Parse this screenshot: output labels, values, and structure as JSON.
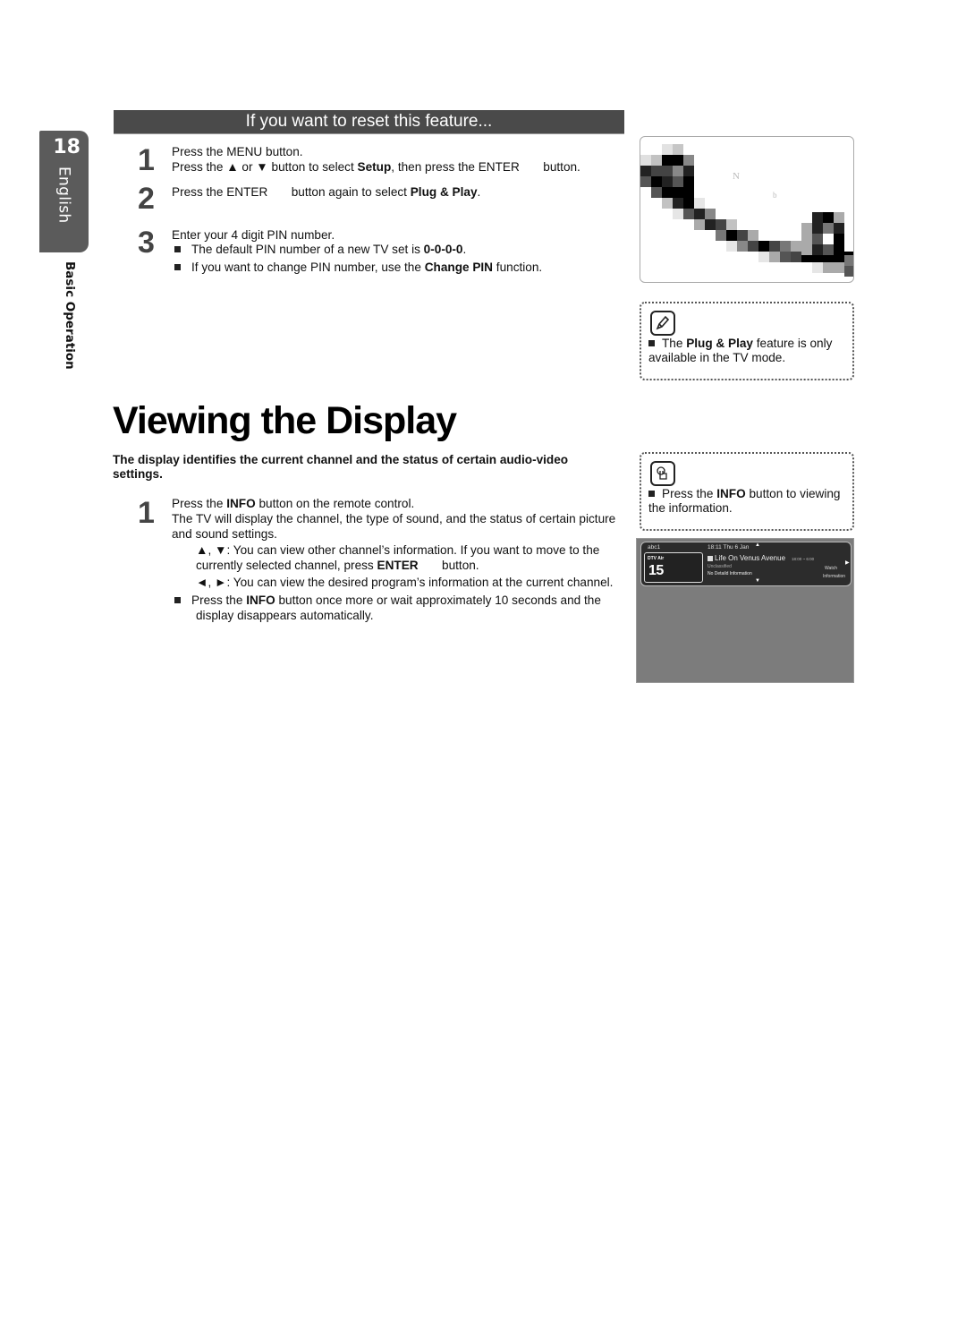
{
  "sidebar": {
    "page_number": "18",
    "language": "English",
    "section": "Basic Operation"
  },
  "reset_section": {
    "title": "If you want to reset this feature...",
    "steps": [
      {
        "number": "1",
        "lines": [
          {
            "parts": [
              "Press the ",
              "MENU",
              " button."
            ]
          },
          {
            "parts": [
              "Press the ▲ or ▼ button to select ",
              "Setup",
              ", then press the ENTER",
              "       button."
            ]
          }
        ]
      },
      {
        "number": "2",
        "lines": [
          {
            "parts": [
              "Press the ENTER",
              "       button again to select ",
              "Plug & Play",
              "."
            ]
          }
        ]
      },
      {
        "number": "3",
        "lines": [
          {
            "parts": [
              "Enter your 4 digit PIN number."
            ]
          }
        ],
        "bullets": [
          {
            "parts": [
              "The default PIN number of a new TV set is ",
              "0-0-0-0",
              "."
            ]
          },
          {
            "parts": [
              "If you want to change PIN number, use the ",
              "Change PIN",
              " function."
            ]
          }
        ]
      }
    ]
  },
  "pixel_image": {
    "faint_letters": [
      "N",
      "b"
    ]
  },
  "note_plug_play": {
    "icon": "note-pencil-icon",
    "parts": [
      "The ",
      "Plug & Play",
      " feature is only available in the TV mode."
    ]
  },
  "viewing": {
    "title": "Viewing the Display",
    "intro": "The display identifies the current channel and the status of certain audio-video settings.",
    "step": {
      "number": "1",
      "line1": [
        "Press the ",
        "INFO",
        " button on the remote control."
      ],
      "line2": "The TV will display the channel, the type of sound, and the status of certain picture and sound settings.",
      "sub1": [
        "▲, ▼: You can view other channel’s information. If you want to move to the currently selected channel, press ",
        "ENTER",
        "       button."
      ],
      "sub2": "◄, ►: You can view the desired program’s information at the current channel.",
      "bullet": [
        "Press the ",
        "INFO",
        " button once more or wait approximately 10 seconds and the display disappears automatically."
      ]
    }
  },
  "note_info": {
    "icon": "hand-press-icon",
    "parts": [
      "Press the ",
      "INFO",
      " button to viewing the information."
    ]
  },
  "tv_osd": {
    "channel_name": "abc1",
    "source": "DTV Air",
    "channel_number": "15",
    "datetime": "18:11 Thu 6 Jan",
    "program": "Life On Venus Avenue",
    "program_time": "18:00 ~ 6:00",
    "rating": "Unclassified",
    "detail": "No Detaild Information",
    "watch_label": "Watch",
    "info_label": "Information"
  },
  "colors": {
    "tab_bg": "#5b5b5b",
    "header_bar_bg": "#4a4a4a",
    "osd_bg": "#2c2c2c",
    "tv_bg": "#7c7c7c"
  }
}
